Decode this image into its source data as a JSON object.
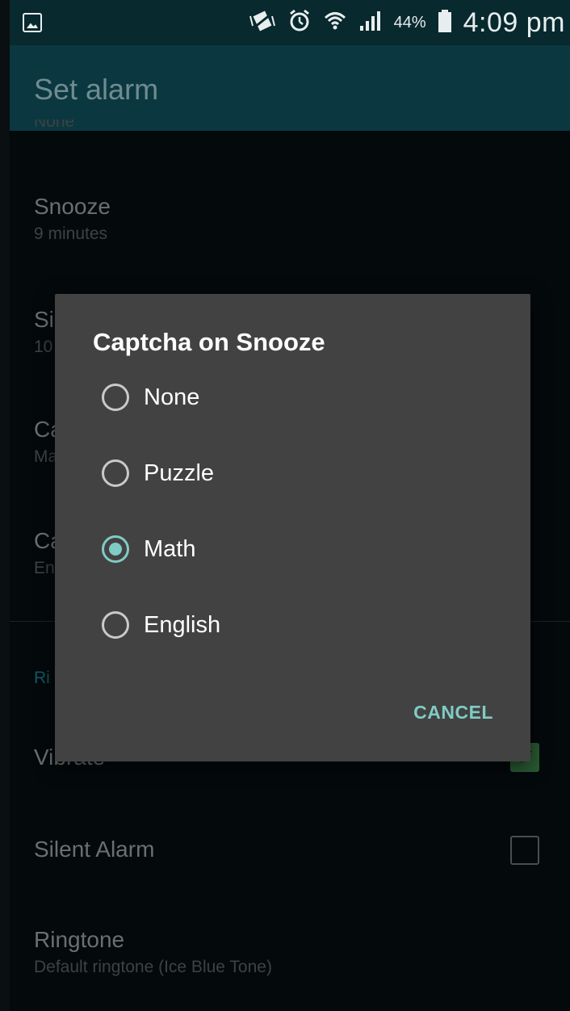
{
  "status_bar": {
    "left_icon": "image-notification-icon",
    "icons": [
      "vibrate-icon",
      "alarm-icon",
      "wifi-icon",
      "signal-icon"
    ],
    "battery_percent": "44%",
    "time": "4:09 pm"
  },
  "app_bar": {
    "title": "Set alarm"
  },
  "settings": {
    "partial_top": "None",
    "snooze": {
      "title": "Snooze",
      "subtitle": "9 minutes"
    },
    "silence_after": {
      "title": "Si",
      "subtitle": "10"
    },
    "captcha_snooze": {
      "title": "Ca",
      "subtitle": "Ma"
    },
    "captcha_dismiss": {
      "title": "Ca",
      "subtitle": "En"
    },
    "ringer_section": "Ri",
    "vibrate": {
      "title": "Vibrate",
      "checked": true
    },
    "silent_alarm": {
      "title": "Silent Alarm",
      "checked": false
    },
    "ringtone": {
      "title": "Ringtone",
      "subtitle": "Default ringtone (Ice Blue Tone)"
    }
  },
  "dialog": {
    "title": "Captcha on Snooze",
    "options": [
      {
        "label": "None",
        "selected": false
      },
      {
        "label": "Puzzle",
        "selected": false
      },
      {
        "label": "Math",
        "selected": true
      },
      {
        "label": "English",
        "selected": false
      }
    ],
    "cancel_label": "CANCEL",
    "accent_color": "#80cbc4"
  }
}
